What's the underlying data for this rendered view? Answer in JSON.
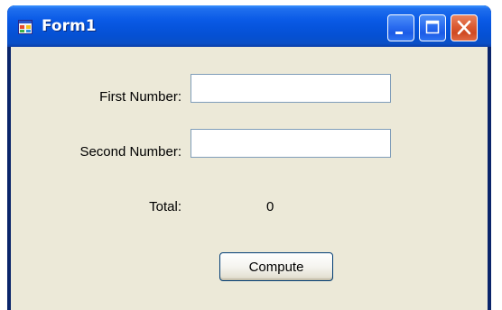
{
  "window": {
    "title": "Form1",
    "controls": {
      "minimize": "minimize-icon",
      "maximize": "maximize-icon",
      "close": "close-icon"
    },
    "colors": {
      "titlebar": "#0654dc",
      "client_background": "#ece9d8",
      "close_button": "#db5a32"
    }
  },
  "form": {
    "first_number_label": "First Number:",
    "first_number_value": "",
    "second_number_label": "Second Number:",
    "second_number_value": "",
    "total_label": "Total:",
    "total_value": "0",
    "compute_label": "Compute"
  }
}
